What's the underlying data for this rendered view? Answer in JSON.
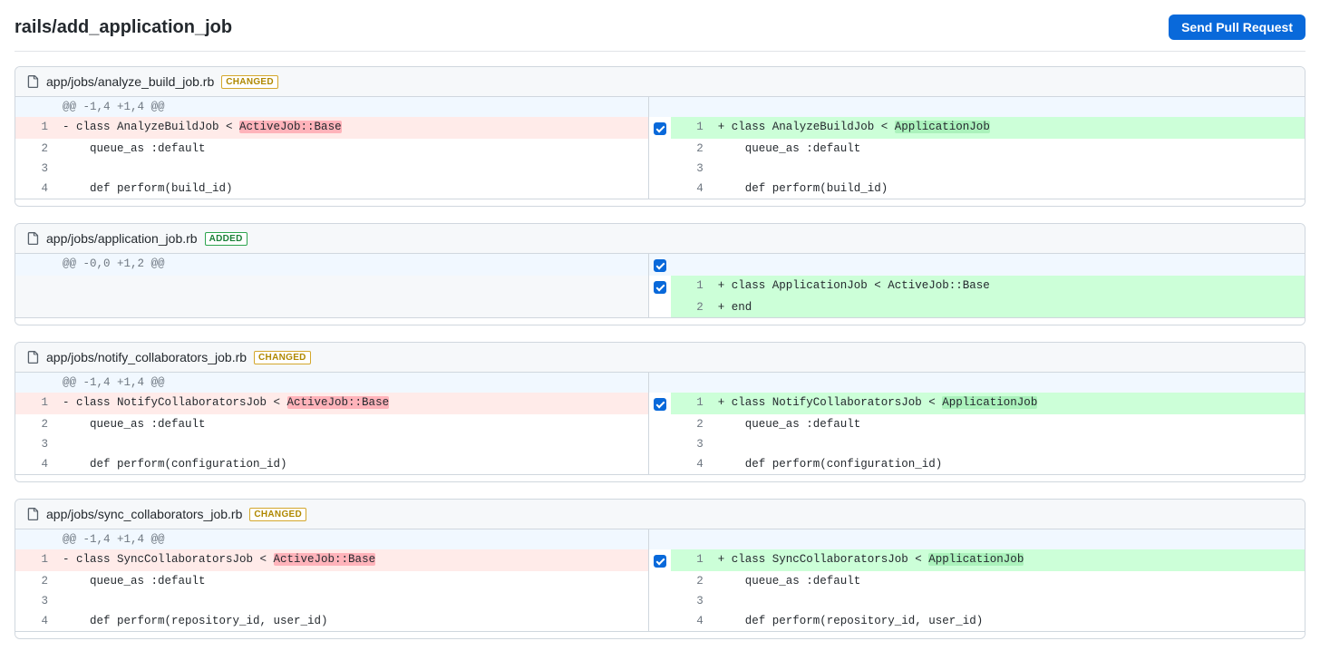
{
  "header": {
    "title": "rails/add_application_job",
    "send_pr_label": "Send Pull Request"
  },
  "badges": {
    "changed": "CHANGED",
    "added": "ADDED"
  },
  "files": [
    {
      "path": "app/jobs/analyze_build_job.rb",
      "status": "changed",
      "hunk": "@@ -1,4 +1,4 @@",
      "rows": [
        {
          "type": "change",
          "ln_l": "1",
          "l_pre": "- class AnalyzeBuildJob < ",
          "l_hl": "ActiveJob::Base",
          "ln_r": "1",
          "r_pre": "+ class AnalyzeBuildJob < ",
          "r_hl": "ApplicationJob",
          "checked": true
        },
        {
          "type": "ctx",
          "ln_l": "2",
          "l": "    queue_as :default",
          "ln_r": "2",
          "r": "    queue_as :default"
        },
        {
          "type": "ctx",
          "ln_l": "3",
          "l": "",
          "ln_r": "3",
          "r": ""
        },
        {
          "type": "ctx",
          "ln_l": "4",
          "l": "    def perform(build_id)",
          "ln_r": "4",
          "r": "    def perform(build_id)"
        }
      ]
    },
    {
      "path": "app/jobs/application_job.rb",
      "status": "added",
      "hunk": "@@ -0,0 +1,2 @@",
      "rows": [
        {
          "type": "addonly",
          "ln_r": "1",
          "r": "+ class ApplicationJob < ActiveJob::Base",
          "checked": true
        },
        {
          "type": "addonly",
          "ln_r": "2",
          "r": "+ end"
        }
      ]
    },
    {
      "path": "app/jobs/notify_collaborators_job.rb",
      "status": "changed",
      "hunk": "@@ -1,4 +1,4 @@",
      "rows": [
        {
          "type": "change",
          "ln_l": "1",
          "l_pre": "- class NotifyCollaboratorsJob < ",
          "l_hl": "ActiveJob::Base",
          "ln_r": "1",
          "r_pre": "+ class NotifyCollaboratorsJob < ",
          "r_hl": "ApplicationJob",
          "checked": true
        },
        {
          "type": "ctx",
          "ln_l": "2",
          "l": "    queue_as :default",
          "ln_r": "2",
          "r": "    queue_as :default"
        },
        {
          "type": "ctx",
          "ln_l": "3",
          "l": "",
          "ln_r": "3",
          "r": ""
        },
        {
          "type": "ctx",
          "ln_l": "4",
          "l": "    def perform(configuration_id)",
          "ln_r": "4",
          "r": "    def perform(configuration_id)"
        }
      ]
    },
    {
      "path": "app/jobs/sync_collaborators_job.rb",
      "status": "changed",
      "hunk": "@@ -1,4 +1,4 @@",
      "rows": [
        {
          "type": "change",
          "ln_l": "1",
          "l_pre": "- class SyncCollaboratorsJob < ",
          "l_hl": "ActiveJob::Base",
          "ln_r": "1",
          "r_pre": "+ class SyncCollaboratorsJob < ",
          "r_hl": "ApplicationJob",
          "checked": true
        },
        {
          "type": "ctx",
          "ln_l": "2",
          "l": "    queue_as :default",
          "ln_r": "2",
          "r": "    queue_as :default"
        },
        {
          "type": "ctx",
          "ln_l": "3",
          "l": "",
          "ln_r": "3",
          "r": ""
        },
        {
          "type": "ctx",
          "ln_l": "4",
          "l": "    def perform(repository_id, user_id)",
          "ln_r": "4",
          "r": "    def perform(repository_id, user_id)"
        }
      ]
    }
  ]
}
